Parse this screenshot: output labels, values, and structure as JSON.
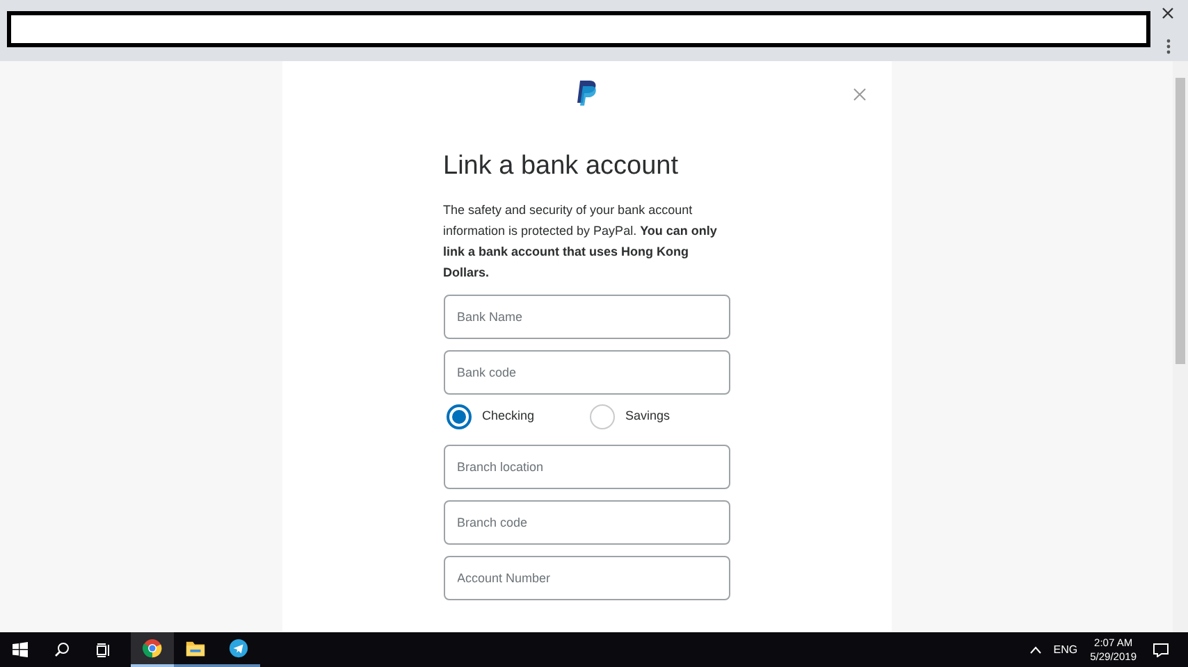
{
  "dialog": {
    "title": "Link a bank account",
    "description": "The safety and security of your bank account information is protected by PayPal. **You can only link a bank account that uses Hong Kong Dollars.**",
    "fields": [
      {
        "kind": "text",
        "placeholder": "Bank Name"
      },
      {
        "kind": "text",
        "placeholder": "Bank code"
      },
      {
        "kind": "radio",
        "options": [
          {
            "label": "Checking",
            "selected": true
          },
          {
            "label": "Savings",
            "selected": false
          }
        ]
      },
      {
        "kind": "text",
        "placeholder": "Branch location"
      },
      {
        "kind": "text",
        "placeholder": "Branch code"
      },
      {
        "kind": "text",
        "placeholder": "Account Number"
      }
    ]
  },
  "taskbar": {
    "apps": [
      {
        "kind": "browser",
        "selected": true
      },
      {
        "kind": "folder",
        "selected": false
      },
      {
        "kind": "messenger",
        "selected": false
      }
    ],
    "language": "ENG",
    "time": "2:07 AM",
    "date": "5/29/2019"
  }
}
